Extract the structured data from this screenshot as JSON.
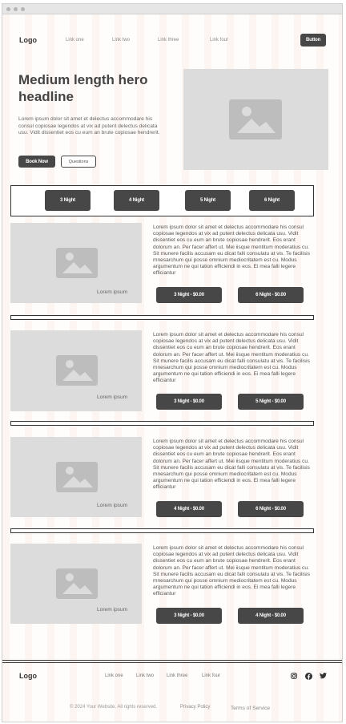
{
  "nav": {
    "logo": "Logo",
    "links": [
      "Link one",
      "Link two",
      "Link three",
      "Link four"
    ],
    "button": "Button"
  },
  "hero": {
    "headline": "Medium length hero headline",
    "text": "Lorem ipsum dolor sit amet et delectus accommodare his consul copiosae legendos at vix ad putent delectus delicata usu. Vidit dissentiet eos cu eum an brute copiosae hendrerit.",
    "primary_button": "Book Now",
    "secondary_button": "Questions",
    "image_icon": "image-placeholder-icon"
  },
  "nights": [
    "3 Night",
    "4 Night",
    "5 Night",
    "6 Night"
  ],
  "cards": [
    {
      "caption": "Lorem ipsum",
      "text": "Lorem ipsum dolor sit amet et delectus accommodare his consul copiosae legendos at vix ad putent delectus delicata usu. Vidit dissentiet eos cu eum an brute copiosae hendrerit. Eos erant dolorum an. Per facer affert ut. Mei iisque mentitum moderatius cu. Sit munere facilis accusam eu dicat falli consulatu at vis. Te facilisis mnesarchum qui posse omnium mediocritatem est cu. Modus argumentum ne qui tation efficiendi in eos. Ei mea falli legere efficiantur",
      "buttons": [
        "3 Night - $0.00",
        "6 Night - $0.00"
      ]
    },
    {
      "caption": "Lorem ipsum",
      "text": "Lorem ipsum dolor sit amet et delectus accommodare his consul copiosae legendos at vix ad putent delectus delicata usu. Vidit dissentiet eos cu eum an brute copiosae hendrerit. Eos erant dolorum an. Per facer affert ut. Mei iisque mentitum moderatius cu. Sit munere facilis accusam eu dicat falli consulatu at vis. Te facilisis mnesarchum qui posse omnium mediocritatem est cu. Modus argumentum ne qui tation efficiendi in eos. Ei mea falli legere efficiantur",
      "buttons": [
        "3 Night - $0.00",
        "5 Night - $0.00"
      ]
    },
    {
      "caption": "Lorem ipsum",
      "text": "Lorem ipsum dolor sit amet et delectus accommodare his consul copiosae legendos at vix ad putent delectus delicata usu. Vidit dissentiet eos cu eum an brute copiosae hendrerit. Eos erant dolorum an. Per facer affert ut. Mei iisque mentitum moderatius cu. Sit munere facilis accusam eu dicat falli consulatu at vis. Te facilisis mnesarchum qui posse omnium mediocritatem est cu. Modus argumentum ne qui tation efficiendi in eos. Ei mea falli legere efficiantur",
      "buttons": [
        "4 Night - $0.00",
        "6 Night - $0.00"
      ]
    },
    {
      "caption": "Lorem ipsum",
      "text": "Lorem ipsum dolor sit amet et delectus accommodare his consul copiosae legendos at vix ad putent delectus delicata usu. Vidit dissentiet eos cu eum an brute copiosae hendrerit. Eos erant dolorum an. Per facer affert ut. Mei iisque mentitum moderatius cu. Sit munere facilis accusam eu dicat falli consulatu at vis. Te facilisis mnesarchum qui posse omnium mediocritatem est cu. Modus argumentum ne qui tation efficiendi in eos. Ei mea falli legere efficiantur",
      "buttons": [
        "3 Night - $0.00",
        "4 Night - $0.00"
      ]
    }
  ],
  "footer": {
    "logo": "Logo",
    "links": [
      "Link one",
      "Link two",
      "Link three",
      "Link four"
    ],
    "social_icons": [
      "instagram-icon",
      "facebook-icon",
      "twitter-icon"
    ],
    "copyright": "© 2024 Your Website. All rights reserved.",
    "privacy": "Privacy Policy",
    "terms": "Terms of Service"
  },
  "colors": {
    "button_dark": "#474747",
    "image_placeholder": "#dcdcdc",
    "background_stripe": "#fdf5f2"
  }
}
